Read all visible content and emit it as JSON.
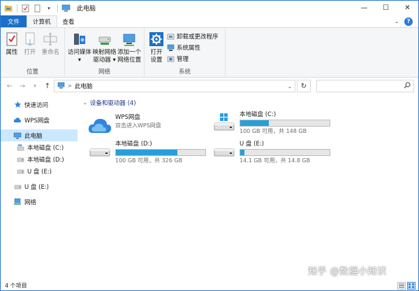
{
  "window": {
    "title": "此电脑",
    "controls": {
      "minimize": "—",
      "maximize": "☐",
      "close": "✕"
    }
  },
  "ribbon_tabs": [
    {
      "label": "文件"
    },
    {
      "label": "计算机"
    },
    {
      "label": "查看"
    }
  ],
  "ribbon": {
    "location_group": {
      "label": "位置",
      "buttons": [
        {
          "label": "属性",
          "icon": "properties-icon"
        },
        {
          "label": "打开",
          "icon": "open-icon"
        },
        {
          "label": "重命名",
          "icon": "rename-icon"
        }
      ]
    },
    "network_group": {
      "label": "网络",
      "buttons": [
        {
          "label_line1": "访问媒体",
          "label_line2": "▾",
          "icon": "media-server-icon"
        },
        {
          "label_line1": "映射网络",
          "label_line2": "驱动器 ▾",
          "icon": "map-drive-icon"
        },
        {
          "label_line1": "添加一个",
          "label_line2": "网络位置",
          "icon": "network-location-icon"
        }
      ]
    },
    "system_group": {
      "label": "系统",
      "open_settings": {
        "label_line1": "打开",
        "label_line2": "设置",
        "icon": "settings-icon"
      },
      "items": [
        {
          "label": "卸载或更改程序",
          "icon": "uninstall-icon"
        },
        {
          "label": "系统属性",
          "icon": "system-properties-icon"
        },
        {
          "label": "管理",
          "icon": "manage-icon"
        }
      ]
    }
  },
  "address_bar": {
    "path": "此电脑",
    "separator": ">"
  },
  "nav_pane": {
    "items": [
      {
        "label": "快速访问",
        "icon": "star-icon",
        "indent": 0,
        "selected": false
      },
      {
        "label": "WPS网盘",
        "icon": "cloud-icon",
        "indent": 0,
        "selected": false
      },
      {
        "label": "此电脑",
        "icon": "computer-icon",
        "indent": 0,
        "selected": true
      },
      {
        "label": "本地磁盘 (C:)",
        "icon": "windows-drive-icon",
        "indent": 1,
        "selected": false
      },
      {
        "label": "本地磁盘 (D:)",
        "icon": "drive-icon",
        "indent": 1,
        "selected": false
      },
      {
        "label": "U 盘 (E:)",
        "icon": "usb-drive-icon",
        "indent": 1,
        "selected": false
      },
      {
        "label": "U 盘 (E:)",
        "icon": "usb-drive-icon",
        "indent": 0,
        "selected": false
      },
      {
        "label": "网络",
        "icon": "network-icon",
        "indent": 0,
        "selected": false
      }
    ]
  },
  "content": {
    "group_header": "设备和驱动器 (4)",
    "drives": [
      {
        "name": "WPS网盘",
        "subtitle": "双击进入WPS网盘",
        "icon": "cloud-icon",
        "has_bar": false,
        "used_fraction": 0
      },
      {
        "name": "本地磁盘 (C:)",
        "subtitle": "100 GB 可用，共 148 GB",
        "icon": "windows-drive-icon",
        "has_bar": true,
        "used_fraction": 0.32
      },
      {
        "name": "本地磁盘 (D:)",
        "subtitle": "100 GB 可用，共 326 GB",
        "icon": "drive-icon",
        "has_bar": true,
        "used_fraction": 0.69
      },
      {
        "name": "U 盘 (E:)",
        "subtitle": "14.1 GB 可用，共 14.8 GB",
        "icon": "usb-drive-icon",
        "has_bar": true,
        "used_fraction": 0.05
      }
    ]
  },
  "status_bar": {
    "item_count": "4 个项目"
  },
  "watermark": "知乎 @数据小知识",
  "colors": {
    "accent": "#1a6fc9",
    "bar_fill": "#26a0da",
    "selection": "#cce8ff",
    "group_header": "#1e3287"
  }
}
